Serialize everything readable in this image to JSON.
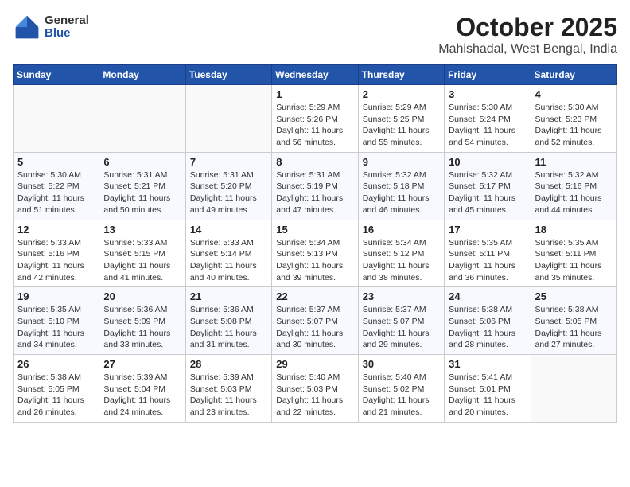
{
  "header": {
    "logo_general": "General",
    "logo_blue": "Blue",
    "month_title": "October 2025",
    "location": "Mahishadal, West Bengal, India"
  },
  "weekdays": [
    "Sunday",
    "Monday",
    "Tuesday",
    "Wednesday",
    "Thursday",
    "Friday",
    "Saturday"
  ],
  "weeks": [
    [
      {
        "day": "",
        "info": ""
      },
      {
        "day": "",
        "info": ""
      },
      {
        "day": "",
        "info": ""
      },
      {
        "day": "1",
        "info": "Sunrise: 5:29 AM\nSunset: 5:26 PM\nDaylight: 11 hours and 56 minutes."
      },
      {
        "day": "2",
        "info": "Sunrise: 5:29 AM\nSunset: 5:25 PM\nDaylight: 11 hours and 55 minutes."
      },
      {
        "day": "3",
        "info": "Sunrise: 5:30 AM\nSunset: 5:24 PM\nDaylight: 11 hours and 54 minutes."
      },
      {
        "day": "4",
        "info": "Sunrise: 5:30 AM\nSunset: 5:23 PM\nDaylight: 11 hours and 52 minutes."
      }
    ],
    [
      {
        "day": "5",
        "info": "Sunrise: 5:30 AM\nSunset: 5:22 PM\nDaylight: 11 hours and 51 minutes."
      },
      {
        "day": "6",
        "info": "Sunrise: 5:31 AM\nSunset: 5:21 PM\nDaylight: 11 hours and 50 minutes."
      },
      {
        "day": "7",
        "info": "Sunrise: 5:31 AM\nSunset: 5:20 PM\nDaylight: 11 hours and 49 minutes."
      },
      {
        "day": "8",
        "info": "Sunrise: 5:31 AM\nSunset: 5:19 PM\nDaylight: 11 hours and 47 minutes."
      },
      {
        "day": "9",
        "info": "Sunrise: 5:32 AM\nSunset: 5:18 PM\nDaylight: 11 hours and 46 minutes."
      },
      {
        "day": "10",
        "info": "Sunrise: 5:32 AM\nSunset: 5:17 PM\nDaylight: 11 hours and 45 minutes."
      },
      {
        "day": "11",
        "info": "Sunrise: 5:32 AM\nSunset: 5:16 PM\nDaylight: 11 hours and 44 minutes."
      }
    ],
    [
      {
        "day": "12",
        "info": "Sunrise: 5:33 AM\nSunset: 5:16 PM\nDaylight: 11 hours and 42 minutes."
      },
      {
        "day": "13",
        "info": "Sunrise: 5:33 AM\nSunset: 5:15 PM\nDaylight: 11 hours and 41 minutes."
      },
      {
        "day": "14",
        "info": "Sunrise: 5:33 AM\nSunset: 5:14 PM\nDaylight: 11 hours and 40 minutes."
      },
      {
        "day": "15",
        "info": "Sunrise: 5:34 AM\nSunset: 5:13 PM\nDaylight: 11 hours and 39 minutes."
      },
      {
        "day": "16",
        "info": "Sunrise: 5:34 AM\nSunset: 5:12 PM\nDaylight: 11 hours and 38 minutes."
      },
      {
        "day": "17",
        "info": "Sunrise: 5:35 AM\nSunset: 5:11 PM\nDaylight: 11 hours and 36 minutes."
      },
      {
        "day": "18",
        "info": "Sunrise: 5:35 AM\nSunset: 5:11 PM\nDaylight: 11 hours and 35 minutes."
      }
    ],
    [
      {
        "day": "19",
        "info": "Sunrise: 5:35 AM\nSunset: 5:10 PM\nDaylight: 11 hours and 34 minutes."
      },
      {
        "day": "20",
        "info": "Sunrise: 5:36 AM\nSunset: 5:09 PM\nDaylight: 11 hours and 33 minutes."
      },
      {
        "day": "21",
        "info": "Sunrise: 5:36 AM\nSunset: 5:08 PM\nDaylight: 11 hours and 31 minutes."
      },
      {
        "day": "22",
        "info": "Sunrise: 5:37 AM\nSunset: 5:07 PM\nDaylight: 11 hours and 30 minutes."
      },
      {
        "day": "23",
        "info": "Sunrise: 5:37 AM\nSunset: 5:07 PM\nDaylight: 11 hours and 29 minutes."
      },
      {
        "day": "24",
        "info": "Sunrise: 5:38 AM\nSunset: 5:06 PM\nDaylight: 11 hours and 28 minutes."
      },
      {
        "day": "25",
        "info": "Sunrise: 5:38 AM\nSunset: 5:05 PM\nDaylight: 11 hours and 27 minutes."
      }
    ],
    [
      {
        "day": "26",
        "info": "Sunrise: 5:38 AM\nSunset: 5:05 PM\nDaylight: 11 hours and 26 minutes."
      },
      {
        "day": "27",
        "info": "Sunrise: 5:39 AM\nSunset: 5:04 PM\nDaylight: 11 hours and 24 minutes."
      },
      {
        "day": "28",
        "info": "Sunrise: 5:39 AM\nSunset: 5:03 PM\nDaylight: 11 hours and 23 minutes."
      },
      {
        "day": "29",
        "info": "Sunrise: 5:40 AM\nSunset: 5:03 PM\nDaylight: 11 hours and 22 minutes."
      },
      {
        "day": "30",
        "info": "Sunrise: 5:40 AM\nSunset: 5:02 PM\nDaylight: 11 hours and 21 minutes."
      },
      {
        "day": "31",
        "info": "Sunrise: 5:41 AM\nSunset: 5:01 PM\nDaylight: 11 hours and 20 minutes."
      },
      {
        "day": "",
        "info": ""
      }
    ]
  ]
}
